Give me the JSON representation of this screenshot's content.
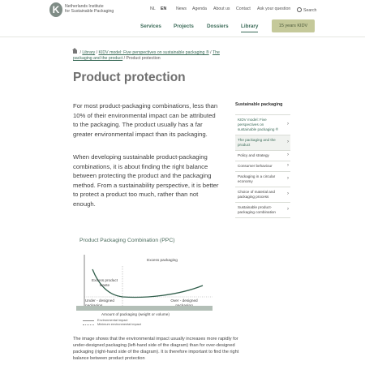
{
  "header": {
    "logo_letter": "K",
    "org_line1": "Netherlands Institute",
    "org_line2": "for Sustainable Packaging",
    "lang_nl": "NL",
    "lang_en": "EN",
    "top_links": [
      "News",
      "Agenda",
      "About us",
      "Contact",
      "Ask your question"
    ],
    "search_label": "Search",
    "main_nav": [
      "Services",
      "Projects",
      "Dossiers",
      "Library"
    ],
    "main_nav_active": "Library",
    "cta_button": "15 years KIDV"
  },
  "breadcrumb": {
    "items": [
      "Library",
      "KIDV model: Five perspectives on sustainable packaging ®",
      "The packaging and the product"
    ],
    "current": "Product protection"
  },
  "page": {
    "title": "Product protection",
    "paragraph1": "For most product-packaging combinations, less than 10% of their environmental impact can be attributed to the packaging. The product usually has a far greater environmental impact than its packaging.",
    "paragraph2": "When developing sustainable product-packaging combinations, it is about finding the right balance between protecting the product and the packaging method. From a sustainability perspective, it is better to protect a product too much, rather than not enough.",
    "paragraph3": "The image shows that the environmental impact usually increases more rapidly for under-designed packaging (left-hand side of the diagram) than for over-designed packaging (right-hand side of the diagram). It is therefore important to find the right balance between product protection"
  },
  "sidebar": {
    "title": "Sustainable packaging",
    "items": [
      "KIDV model: Five perspectives on sustainable packaging ®",
      "The packaging and the product",
      "Policy and strategy",
      "Consumer behaviour",
      "Packaging in a circular economy",
      "Choice of material and packaging process",
      "Sustainable product-packaging combination"
    ]
  },
  "diagram": {
    "title": "Product Packaging Combination (PPC)",
    "label_excess_waste": "Excess product waste",
    "label_excess_packaging": "Excess packaging",
    "label_under": "Under - designed packaging",
    "label_over": "Over - designed packaging",
    "axis_label": "Amount of packaging (weight or volume)",
    "legend_env": "Environmental impact",
    "legend_min": "Minimum environmental impact",
    "colors": {
      "curve": "#2f5d4a",
      "bar": "#b3bfb7",
      "accent": "#3b6b58"
    }
  },
  "icons": [
    "search-icon",
    "home-icon",
    "chevron-right-icon"
  ]
}
